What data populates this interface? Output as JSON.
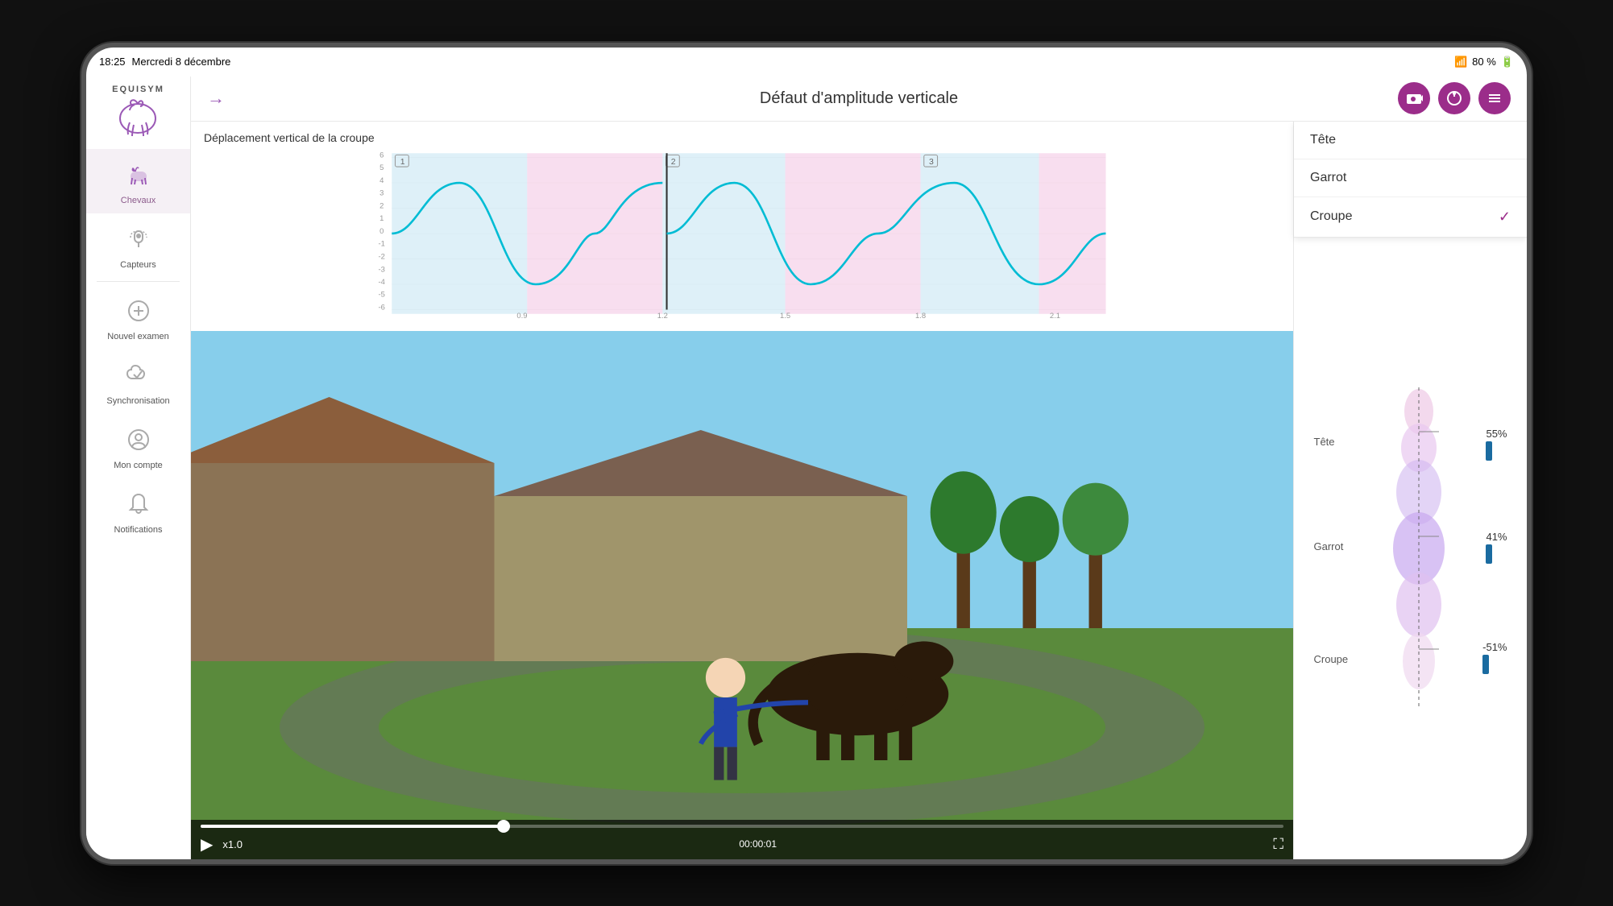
{
  "statusBar": {
    "time": "18:25",
    "date": "Mercredi 8 décembre",
    "battery": "80 %",
    "wifi": "wifi"
  },
  "header": {
    "title": "Défaut d'amplitude verticale",
    "backLabel": "→",
    "cameraLabel": "📹",
    "refreshLabel": "⊕",
    "menuLabel": "☰"
  },
  "chart": {
    "title": "Déplacement vertical de la croupe",
    "yAxisValues": [
      "6",
      "5",
      "4",
      "3",
      "2",
      "1",
      "0",
      "-1",
      "-2",
      "-3",
      "-4",
      "-5",
      "-6"
    ],
    "xAxisValues": [
      "0,9",
      "1,2",
      "1,5",
      "1,8",
      "2,1"
    ],
    "segments": [
      "1",
      "2",
      "3"
    ]
  },
  "sidebar": {
    "logo": "EQUISYM",
    "items": [
      {
        "label": "Chevaux",
        "icon": "horse",
        "active": true
      },
      {
        "label": "Capteurs",
        "icon": "sensor",
        "active": false
      },
      {
        "label": "Nouvel examen",
        "icon": "plus-circle",
        "active": false
      },
      {
        "label": "Synchronisation",
        "icon": "cloud-check",
        "active": false
      },
      {
        "label": "Mon compte",
        "icon": "person-circle",
        "active": false
      },
      {
        "label": "Notifications",
        "icon": "bell",
        "active": false
      }
    ]
  },
  "dropdown": {
    "items": [
      {
        "label": "Tête",
        "selected": false
      },
      {
        "label": "Garrot",
        "selected": false
      },
      {
        "label": "Croupe",
        "selected": true
      }
    ]
  },
  "horseDiagram": {
    "labels": [
      "Tête",
      "Garrot",
      "Croupe"
    ],
    "values": [
      "55%",
      "41%",
      "-51%"
    ]
  },
  "video": {
    "timestamp": "00:00:01",
    "speed": "x1.0",
    "progress": 28
  }
}
